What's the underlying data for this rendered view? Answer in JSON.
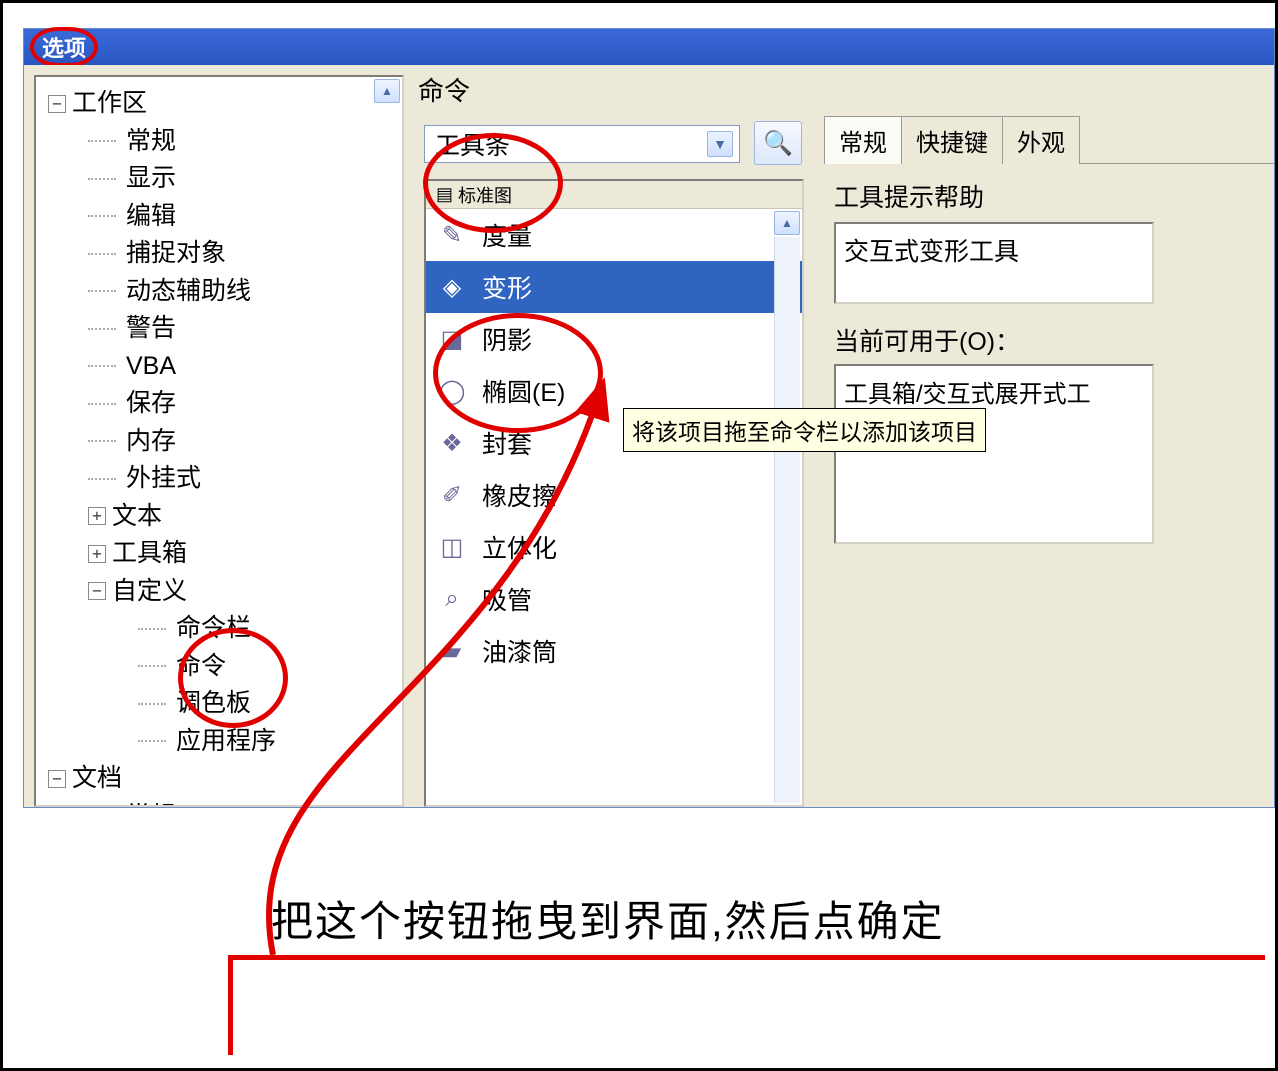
{
  "titlebar": {
    "badge": "选项"
  },
  "tree": {
    "root1": {
      "label": "工作区"
    },
    "items1": [
      {
        "label": "常规"
      },
      {
        "label": "显示"
      },
      {
        "label": "编辑"
      },
      {
        "label": "捕捉对象"
      },
      {
        "label": "动态辅助线"
      },
      {
        "label": "警告"
      },
      {
        "label": "VBA"
      },
      {
        "label": "保存"
      },
      {
        "label": "内存"
      },
      {
        "label": "外挂式"
      }
    ],
    "text_node": {
      "label": "文本"
    },
    "toolbox_node": {
      "label": "工具箱"
    },
    "custom_node": {
      "label": "自定义"
    },
    "custom_children": [
      {
        "label": "命令栏"
      },
      {
        "label": "命令"
      },
      {
        "label": "调色板"
      },
      {
        "label": "应用程序"
      }
    ],
    "root2": {
      "label": "文档"
    },
    "items2": [
      {
        "label": "常规"
      }
    ]
  },
  "right": {
    "section_title": "命令",
    "combo_value": "工具条",
    "list_header": "标准图",
    "commands": [
      {
        "icon": "measure-icon",
        "glyph": "✎",
        "label": "度量"
      },
      {
        "icon": "distort-icon",
        "glyph": "◈",
        "label": "变形"
      },
      {
        "icon": "shadow-icon",
        "glyph": "◪",
        "label": "阴影"
      },
      {
        "icon": "ellipse-icon",
        "glyph": "◯",
        "label": "椭圆(E)"
      },
      {
        "icon": "envelope-icon",
        "glyph": "❖",
        "label": "封套"
      },
      {
        "icon": "eraser-icon",
        "glyph": "✐",
        "label": "橡皮擦"
      },
      {
        "icon": "extrude-icon",
        "glyph": "◫",
        "label": "立体化"
      },
      {
        "icon": "eyedropper-icon",
        "glyph": "⌕",
        "label": "吸管"
      },
      {
        "icon": "paintbucket-icon",
        "glyph": "▰",
        "label": "油漆筒"
      }
    ]
  },
  "props": {
    "tabs": [
      {
        "label": "常规",
        "active": true
      },
      {
        "label": "快捷键",
        "active": false
      },
      {
        "label": "外观",
        "active": false
      }
    ],
    "tooltip_label": "工具提示帮助",
    "tooltip_value": "交互式变形工具",
    "available_label": "当前可用于(O)：",
    "available_value": "工具箱/交互式展开式工"
  },
  "tooltip_text": "将该项目拖至命令栏以添加该项目",
  "caption": "把这个按钮拖曳到界面,然后点确定"
}
